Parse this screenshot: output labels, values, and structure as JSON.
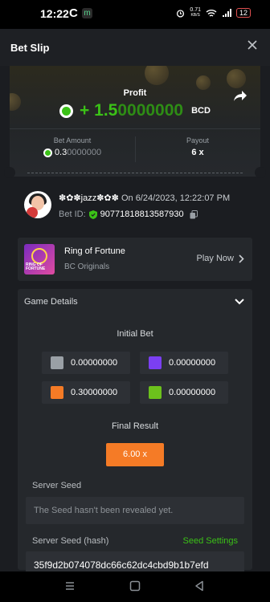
{
  "status_bar": {
    "time": "12:22",
    "app_icon_c": "C",
    "app_icon_m": "m",
    "net_speed_top": "0.71",
    "net_speed_unit": "KB/S",
    "battery": "12"
  },
  "header": {
    "title": "Bet Slip"
  },
  "profit": {
    "label": "Profit",
    "value_bright": "+ 1.5",
    "value_dim": "0000000",
    "currency": "BCD"
  },
  "bet_amount": {
    "label": "Bet Amount",
    "value_bright": "0.3",
    "value_dim": "0000000"
  },
  "payout": {
    "label": "Payout",
    "value": "6 x"
  },
  "user": {
    "name": "✽✿✽jazz✽✿✽",
    "date_prefix": "On",
    "datetime": "6/24/2023, 12:22:07 PM",
    "bet_id_label": "Bet ID:",
    "bet_id": "90771818813587930"
  },
  "game": {
    "thumb_text": "RING OF FORTUNE",
    "name": "Ring of Fortune",
    "provider": "BC Originals",
    "play_label": "Play Now"
  },
  "details": {
    "title": "Game Details",
    "initial_bet_label": "Initial Bet",
    "bets": [
      {
        "color_name": "grey",
        "color": "#9aa0a6",
        "value": "0.00000000"
      },
      {
        "color_name": "purple",
        "color": "#7b3ff2",
        "value": "0.00000000"
      },
      {
        "color_name": "orange",
        "color": "#f57b26",
        "value": "0.30000000"
      },
      {
        "color_name": "green",
        "color": "#6cc11c",
        "value": "0.00000000"
      }
    ],
    "final_result_label": "Final Result",
    "final_result": "6.00 x",
    "server_seed_label": "Server Seed",
    "server_seed_placeholder": "The Seed hasn't been revealed yet.",
    "server_seed_hash_label": "Server Seed (hash)",
    "seed_settings_label": "Seed Settings",
    "server_seed_hash": "35f9d2b074078dc66c62dc4cbd9b1b7efd"
  },
  "colors": {
    "accent_green": "#3bc117",
    "orange": "#f57b26"
  }
}
